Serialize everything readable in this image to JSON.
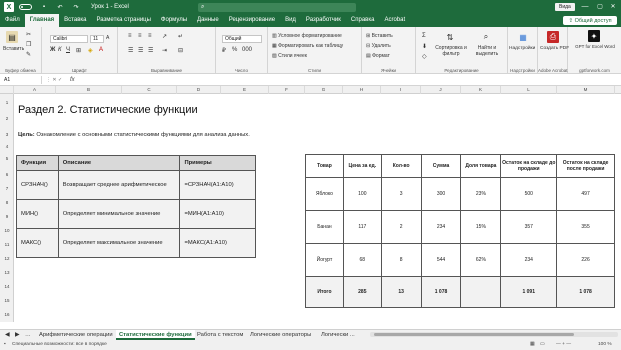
{
  "titlebar": {
    "autosave_toggle": "",
    "doc_title": "Урок 1 - Excel",
    "search_placeholder": "",
    "user": "Вида",
    "min": "—",
    "max": "▢",
    "close": "✕"
  },
  "menu": {
    "tabs": [
      "Файл",
      "Главная",
      "Вставка",
      "Разметка страницы",
      "Формулы",
      "Данные",
      "Рецензирование",
      "Вид",
      "Разработчик",
      "Справка",
      "Acrobat"
    ],
    "share_label": "Общий доступ"
  },
  "ribbon": {
    "paste_label": "Вставить",
    "clipboard_label": "Буфер обмена",
    "font_name": "Calibri",
    "font_size": "11",
    "font_label": "Шрифт",
    "align_label": "Выравнивание",
    "number_format": "Общий",
    "number_label": "Число",
    "cond_format": "Условное форматирование",
    "format_table": "Форматировать как таблицу",
    "cell_styles": "Стили ячеек",
    "styles_label": "Стили",
    "insert_cells": "Вставить",
    "delete_cells": "Удалить",
    "format_cells": "Формат",
    "cells_label": "Ячейки",
    "sort_filter": "Сортировка и фильтр",
    "find_select": "Найти и выделить",
    "editing_label": "Редактирование",
    "addins": "Надстройки",
    "addins_label": "Надстройки",
    "create_pdf": "Создать PDF",
    "acrobat_label": "Adobe Acrobat",
    "gpt_label": "GPT for Excel Word",
    "gpt_sub": "gptforwork.com"
  },
  "formula": {
    "cell_ref": "A1",
    "fx": "fx"
  },
  "columns": [
    "A",
    "B",
    "C",
    "D",
    "E",
    "F",
    "G",
    "H",
    "I",
    "J",
    "K",
    "L",
    "M"
  ],
  "rows": [
    "1",
    "2",
    "3",
    "4",
    "5",
    "6",
    "7",
    "8",
    "9",
    "10",
    "11",
    "12",
    "13",
    "14",
    "15",
    "16",
    "17",
    "18"
  ],
  "sheet": {
    "title": "Раздел 2. Статистические функции",
    "goal_label": "Цель:",
    "goal_text": " Ознакомление с основными статистическими функциями для анализа данных."
  },
  "func_table": {
    "headers": [
      "Функция",
      "Описание",
      "Примеры"
    ],
    "rows": [
      [
        "СРЗНАЧ()",
        "Возвращает среднее арифметическое",
        "=СРЗНАЧ(A1:A10)"
      ],
      [
        "МИН()",
        "Определяет минимальное значение",
        "=МИН(A1:A10)"
      ],
      [
        "МАКС()",
        "Определяет максимальное значение",
        "=МАКС(A1:A10)"
      ]
    ]
  },
  "prod_table": {
    "headers": [
      "Товар",
      "Цена за ед.",
      "Кол-во",
      "Сумма",
      "Доля товара",
      "Остаток на складе до продажи",
      "Остаток на складе после продажи"
    ],
    "rows": [
      [
        "Яблоко",
        "100",
        "3",
        "300",
        "23%",
        "500",
        "497"
      ],
      [
        "Банан",
        "117",
        "2",
        "234",
        "15%",
        "357",
        "355"
      ],
      [
        "Йогурт",
        "68",
        "8",
        "544",
        "62%",
        "234",
        "226"
      ]
    ],
    "total": [
      "Итого",
      "285",
      "13",
      "1 078",
      "",
      "1 091",
      "1 078"
    ]
  },
  "tabs": [
    "Арифметические операции",
    "Статистические функции",
    "Работа с текстом",
    "Логические операторы",
    "Логически ..."
  ],
  "status": {
    "ready": "Специальные возможности: все в порядке",
    "zoom": "100 %"
  }
}
